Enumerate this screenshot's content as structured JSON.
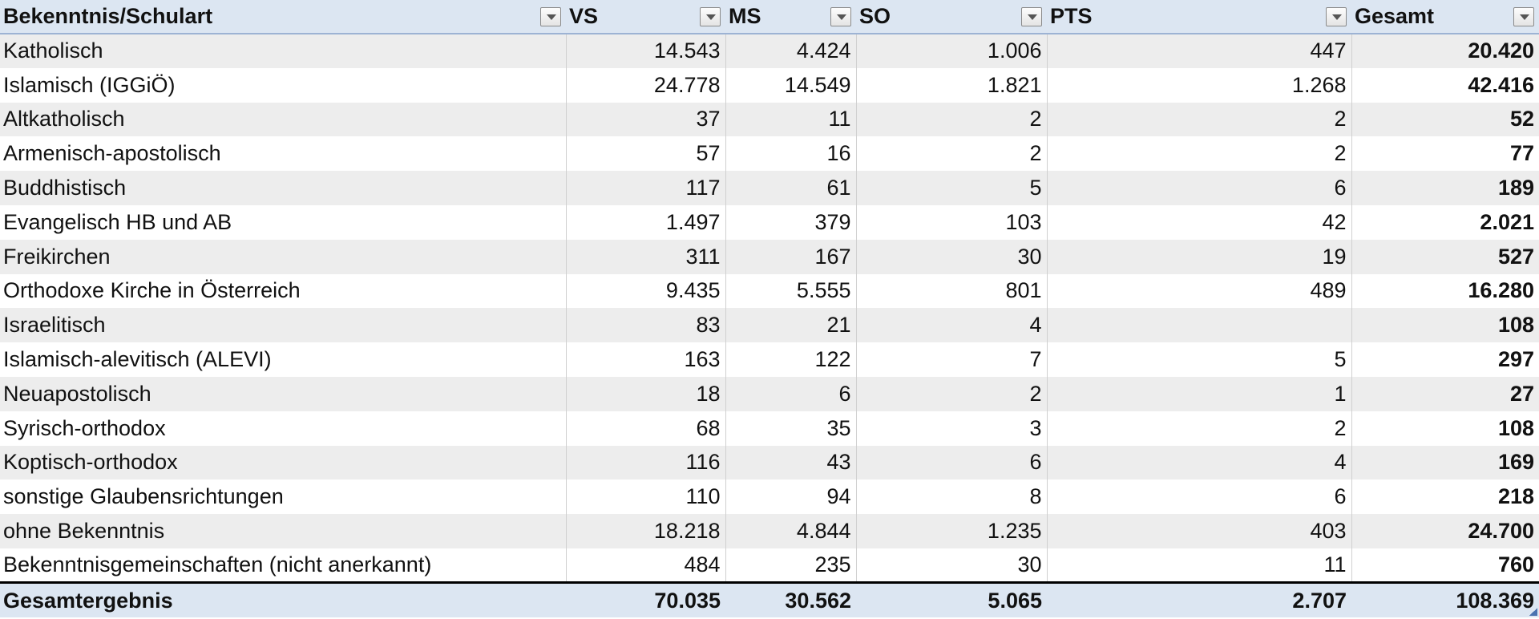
{
  "headers": [
    {
      "label": "Bekenntnis/Schulart",
      "filter_icon": "dropdown-arrow"
    },
    {
      "label": "VS",
      "filter_icon": "dropdown-arrow"
    },
    {
      "label": "MS",
      "filter_icon": "dropdown-arrow"
    },
    {
      "label": "SO",
      "filter_icon": "dropdown-arrow"
    },
    {
      "label": "PTS",
      "filter_icon": "dropdown-arrow"
    },
    {
      "label": "Gesamt",
      "filter_icon": "dropdown-arrow"
    }
  ],
  "rows": [
    {
      "label": "Katholisch",
      "vs": "14.543",
      "ms": "4.424",
      "so": "1.006",
      "pts": "447",
      "gesamt": "20.420"
    },
    {
      "label": "Islamisch (IGGiÖ)",
      "vs": "24.778",
      "ms": "14.549",
      "so": "1.821",
      "pts": "1.268",
      "gesamt": "42.416"
    },
    {
      "label": "Altkatholisch",
      "vs": "37",
      "ms": "11",
      "so": "2",
      "pts": "2",
      "gesamt": "52"
    },
    {
      "label": "Armenisch-apostolisch",
      "vs": "57",
      "ms": "16",
      "so": "2",
      "pts": "2",
      "gesamt": "77"
    },
    {
      "label": "Buddhistisch",
      "vs": "117",
      "ms": "61",
      "so": "5",
      "pts": "6",
      "gesamt": "189"
    },
    {
      "label": "Evangelisch HB und AB",
      "vs": "1.497",
      "ms": "379",
      "so": "103",
      "pts": "42",
      "gesamt": "2.021"
    },
    {
      "label": "Freikirchen",
      "vs": "311",
      "ms": "167",
      "so": "30",
      "pts": "19",
      "gesamt": "527"
    },
    {
      "label": "Orthodoxe Kirche in Österreich",
      "vs": "9.435",
      "ms": "5.555",
      "so": "801",
      "pts": "489",
      "gesamt": "16.280"
    },
    {
      "label": "Israelitisch",
      "vs": "83",
      "ms": "21",
      "so": "4",
      "pts": "",
      "gesamt": "108"
    },
    {
      "label": "Islamisch-alevitisch (ALEVI)",
      "vs": "163",
      "ms": "122",
      "so": "7",
      "pts": "5",
      "gesamt": "297"
    },
    {
      "label": "Neuapostolisch",
      "vs": "18",
      "ms": "6",
      "so": "2",
      "pts": "1",
      "gesamt": "27"
    },
    {
      "label": "Syrisch-orthodox",
      "vs": "68",
      "ms": "35",
      "so": "3",
      "pts": "2",
      "gesamt": "108"
    },
    {
      "label": "Koptisch-orthodox",
      "vs": "116",
      "ms": "43",
      "so": "6",
      "pts": "4",
      "gesamt": "169"
    },
    {
      "label": "sonstige Glaubensrichtungen",
      "vs": "110",
      "ms": "94",
      "so": "8",
      "pts": "6",
      "gesamt": "218"
    },
    {
      "label": "ohne Bekenntnis",
      "vs": "18.218",
      "ms": "4.844",
      "so": "1.235",
      "pts": "403",
      "gesamt": "24.700"
    },
    {
      "label": "Bekenntnisgemeinschaften (nicht anerkannt)",
      "vs": "484",
      "ms": "235",
      "so": "30",
      "pts": "11",
      "gesamt": "760"
    }
  ],
  "total": {
    "label": "Gesamtergebnis",
    "vs": "70.035",
    "ms": "30.562",
    "so": "5.065",
    "pts": "2.707",
    "gesamt": "108.369"
  },
  "colors": {
    "header_bg": "#dce6f2",
    "band_odd": "#ededed",
    "band_even": "#ffffff"
  }
}
